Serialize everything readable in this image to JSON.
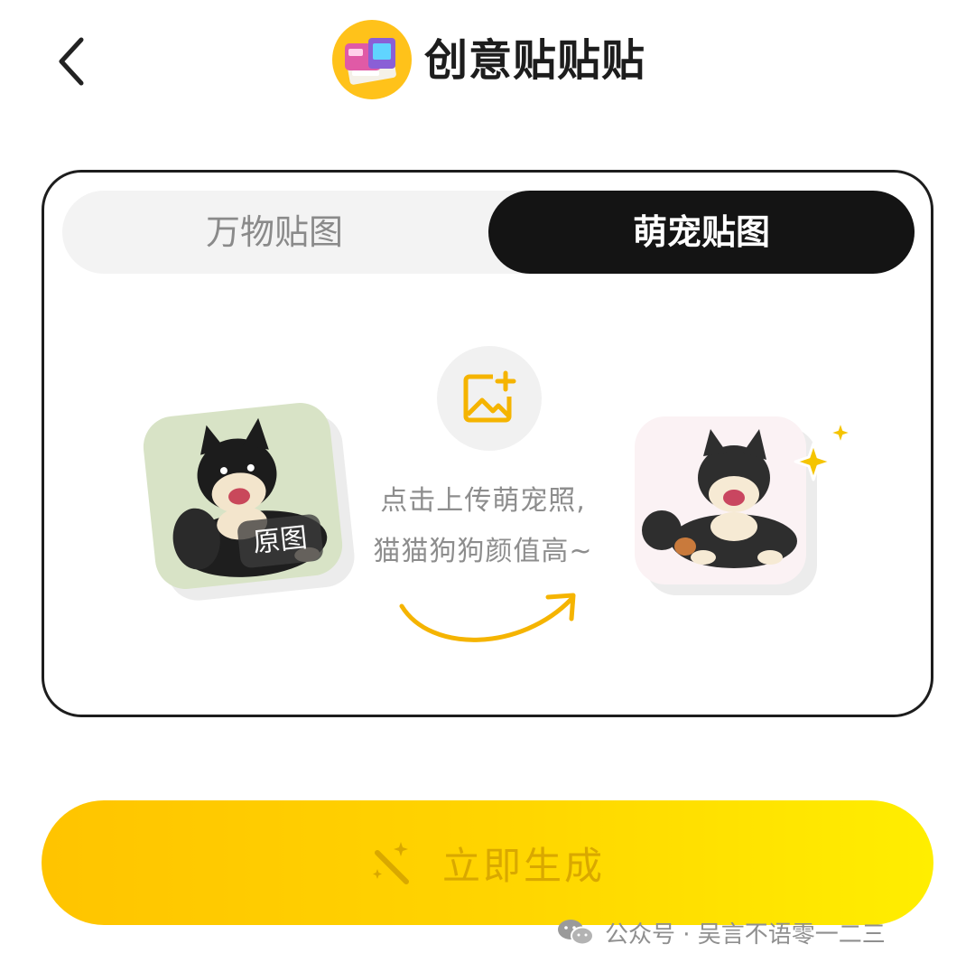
{
  "header": {
    "back_icon": "chevron-left-icon",
    "logo_icon": "sticker-printer-logo",
    "title": "创意贴贴贴"
  },
  "tabs": [
    {
      "label": "万物贴图",
      "active": false
    },
    {
      "label": "萌宠贴图",
      "active": true
    }
  ],
  "upload": {
    "icon": "add-image-icon",
    "hint_line1": "点击上传萌宠照,",
    "hint_line2": "猫猫狗狗颜值高~"
  },
  "original_photo": {
    "label": "原图"
  },
  "generate_button": {
    "icon": "magic-wand-icon",
    "label": "立即生成"
  },
  "watermark": {
    "icon": "wechat-icon",
    "text": "公众号 · 吴言不语零一二三"
  },
  "colors": {
    "accent": "#ffc21a",
    "active_tab": "#141414",
    "button_gradient_start": "#ffc400",
    "button_gradient_end": "#ffee00"
  }
}
